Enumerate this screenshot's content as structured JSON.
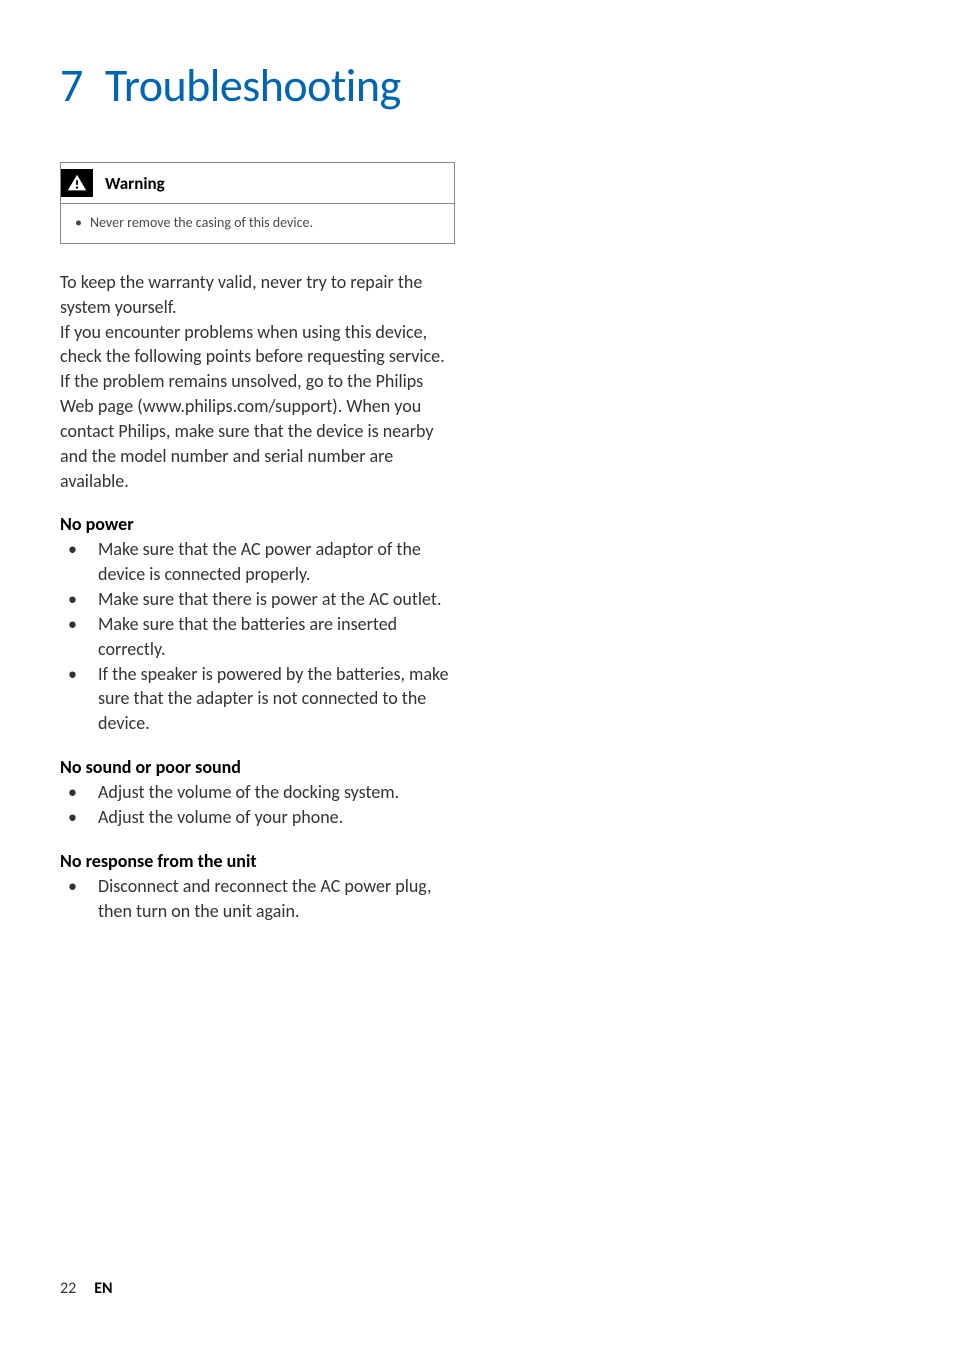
{
  "chapter": {
    "number": "7",
    "title": "Troubleshooting"
  },
  "warning": {
    "label": "Warning",
    "items": [
      "Never remove the casing of this device."
    ]
  },
  "intro": "To keep the warranty valid, never try to repair the system yourself.\nIf you encounter problems when using this device, check the following points before requesting service. If the problem remains unsolved, go to the Philips Web page (www.philips.com/support). When you contact Philips, make sure that the device is nearby and the model number and serial number are available.",
  "sections": [
    {
      "heading": "No power",
      "items": [
        "Make sure that the AC power adaptor of the device is connected properly.",
        "Make sure that there is power at the AC outlet.",
        "Make sure that the batteries are inserted correctly.",
        "If the speaker is powered by the batteries, make sure that the adapter is not connected to the device."
      ]
    },
    {
      "heading": "No sound or poor sound",
      "items": [
        "Adjust the volume of the docking system.",
        "Adjust the volume of your phone."
      ]
    },
    {
      "heading": "No response from the unit",
      "items": [
        "Disconnect and reconnect the AC power plug, then turn on the unit again."
      ]
    }
  ],
  "footer": {
    "page_number": "22",
    "lang": "EN"
  }
}
